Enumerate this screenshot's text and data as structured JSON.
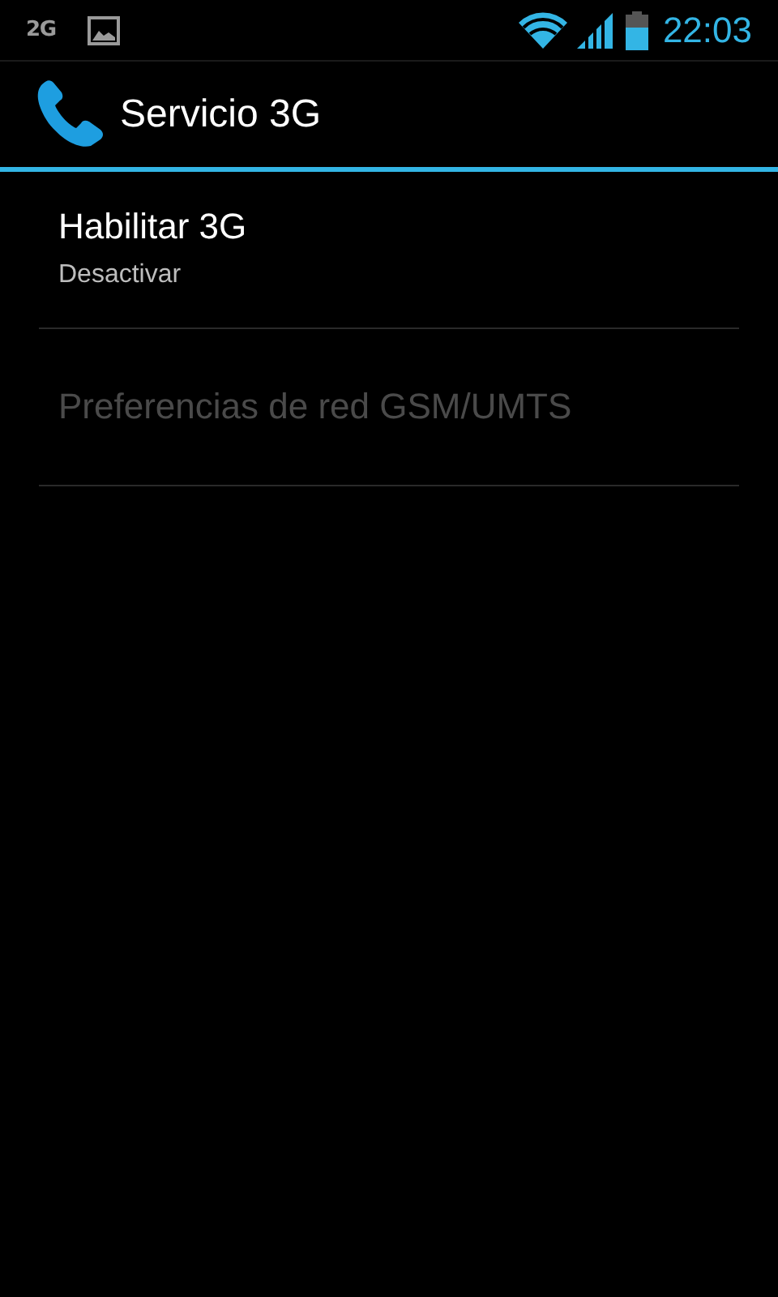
{
  "status_bar": {
    "network_type": "2G",
    "time": "22:03"
  },
  "action_bar": {
    "title": "Servicio 3G"
  },
  "preferences": [
    {
      "title": "Habilitar 3G",
      "summary": "Desactivar",
      "disabled": false
    },
    {
      "title": "Preferencias de red GSM/UMTS",
      "disabled": true
    }
  ]
}
